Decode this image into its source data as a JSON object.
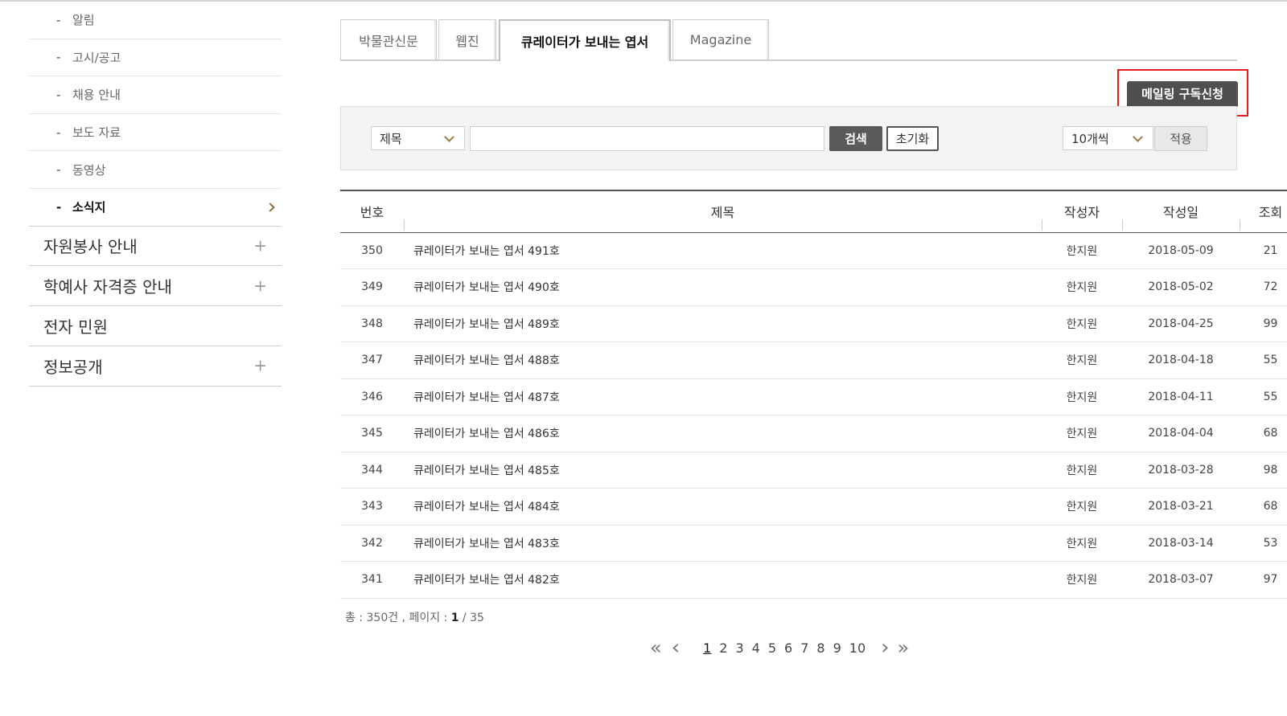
{
  "sidebar": {
    "sub_items": [
      {
        "label": "알림",
        "active": false
      },
      {
        "label": "고시/공고",
        "active": false
      },
      {
        "label": "채용 안내",
        "active": false
      },
      {
        "label": "보도 자료",
        "active": false
      },
      {
        "label": "동영상",
        "active": false
      },
      {
        "label": "소식지",
        "active": true
      }
    ],
    "main_items": [
      {
        "label": "자원봉사 안내",
        "expandable": true
      },
      {
        "label": "학예사 자격증 안내",
        "expandable": true
      },
      {
        "label": "전자 민원",
        "expandable": false
      },
      {
        "label": "정보공개",
        "expandable": true
      }
    ],
    "dash": "-",
    "plus": "+"
  },
  "tabs": [
    {
      "label": "박물관신문",
      "active": false
    },
    {
      "label": "웹진",
      "active": false
    },
    {
      "label": "큐레이터가 보내는 엽서",
      "active": true
    },
    {
      "label": "Magazine",
      "active": false
    }
  ],
  "mailing": {
    "label": "메일링 구독신청"
  },
  "search": {
    "field_select": "제목",
    "query": "",
    "search_label": "검색",
    "reset_label": "초기화",
    "per_page_select": "10개씩",
    "apply_label": "적용"
  },
  "table": {
    "headers": {
      "no": "번호",
      "title": "제목",
      "author": "작성자",
      "date": "작성일",
      "views": "조회"
    },
    "rows": [
      {
        "no": "350",
        "title": "큐레이터가 보내는 엽서 491호",
        "author": "한지원",
        "date": "2018-05-09",
        "views": "21"
      },
      {
        "no": "349",
        "title": "큐레이터가 보내는 엽서 490호",
        "author": "한지원",
        "date": "2018-05-02",
        "views": "72"
      },
      {
        "no": "348",
        "title": "큐레이터가 보내는 엽서 489호",
        "author": "한지원",
        "date": "2018-04-25",
        "views": "99"
      },
      {
        "no": "347",
        "title": "큐레이터가 보내는 엽서 488호",
        "author": "한지원",
        "date": "2018-04-18",
        "views": "55"
      },
      {
        "no": "346",
        "title": "큐레이터가 보내는 엽서 487호",
        "author": "한지원",
        "date": "2018-04-11",
        "views": "55"
      },
      {
        "no": "345",
        "title": "큐레이터가 보내는 엽서 486호",
        "author": "한지원",
        "date": "2018-04-04",
        "views": "68"
      },
      {
        "no": "344",
        "title": "큐레이터가 보내는 엽서 485호",
        "author": "한지원",
        "date": "2018-03-28",
        "views": "98"
      },
      {
        "no": "343",
        "title": "큐레이터가 보내는 엽서 484호",
        "author": "한지원",
        "date": "2018-03-21",
        "views": "68"
      },
      {
        "no": "342",
        "title": "큐레이터가 보내는 엽서 483호",
        "author": "한지원",
        "date": "2018-03-14",
        "views": "53"
      },
      {
        "no": "341",
        "title": "큐레이터가 보내는 엽서 482호",
        "author": "한지원",
        "date": "2018-03-07",
        "views": "97"
      }
    ]
  },
  "summary": {
    "total_prefix": "총 : ",
    "total_count": "350건",
    "page_prefix": " , 페이지 : ",
    "current_page": "1",
    "page_suffix": " / 35"
  },
  "pagination": {
    "first": "«",
    "prev": "‹",
    "next": "›",
    "last": "»",
    "pages": [
      "1",
      "2",
      "3",
      "4",
      "5",
      "6",
      "7",
      "8",
      "9",
      "10"
    ],
    "current": "1"
  },
  "colors": {
    "accent_brown": "#8a6a43",
    "highlight_red": "#e21b1b",
    "dark_button": "#4f4f4f"
  }
}
